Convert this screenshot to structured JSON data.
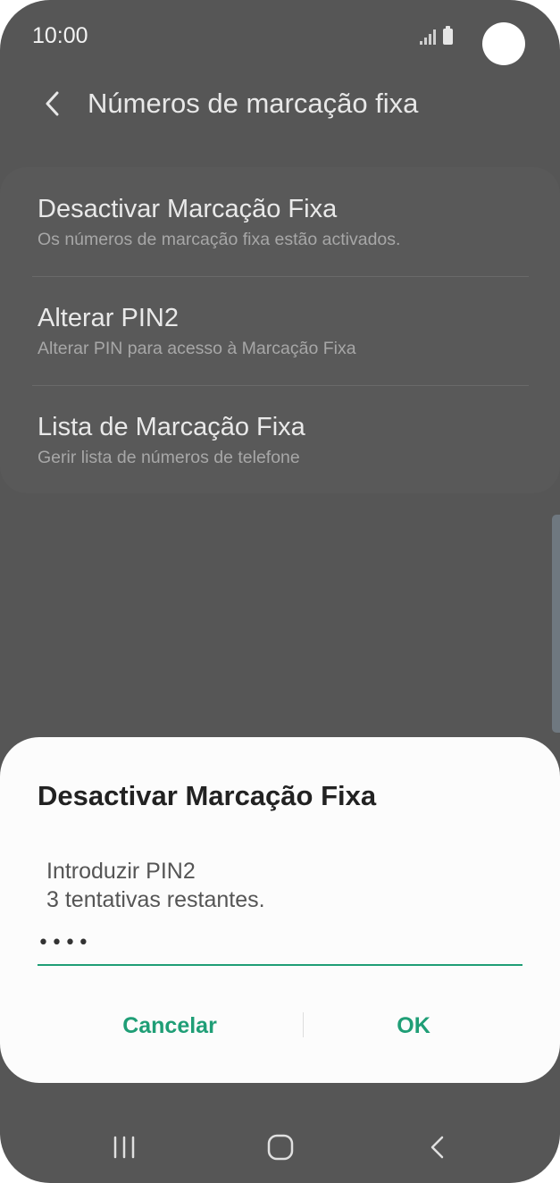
{
  "status_bar": {
    "time": "10:00"
  },
  "header": {
    "title": "Números de marcação fixa",
    "back_icon": "chevron-left-icon"
  },
  "settings": {
    "items": [
      {
        "title": "Desactivar Marcação Fixa",
        "subtitle": "Os números de marcação fixa estão activados."
      },
      {
        "title": "Alterar PIN2",
        "subtitle": "Alterar PIN para acesso à Marcação Fixa"
      },
      {
        "title": "Lista de Marcação Fixa",
        "subtitle": "Gerir lista de números de telefone"
      }
    ]
  },
  "dialog": {
    "title": "Desactivar Marcação Fixa",
    "message_line1": "Introduzir PIN2",
    "message_line2": "3 tentativas restantes.",
    "pin_value": "••••",
    "cancel_label": "Cancelar",
    "ok_label": "OK"
  },
  "colors": {
    "accent": "#1f9e76",
    "dim_background": "#565656",
    "dialog_background": "#fcfcfc"
  },
  "nav_bar": {
    "recent_icon": "recent-apps-icon",
    "home_icon": "home-icon",
    "back_icon": "back-icon"
  }
}
